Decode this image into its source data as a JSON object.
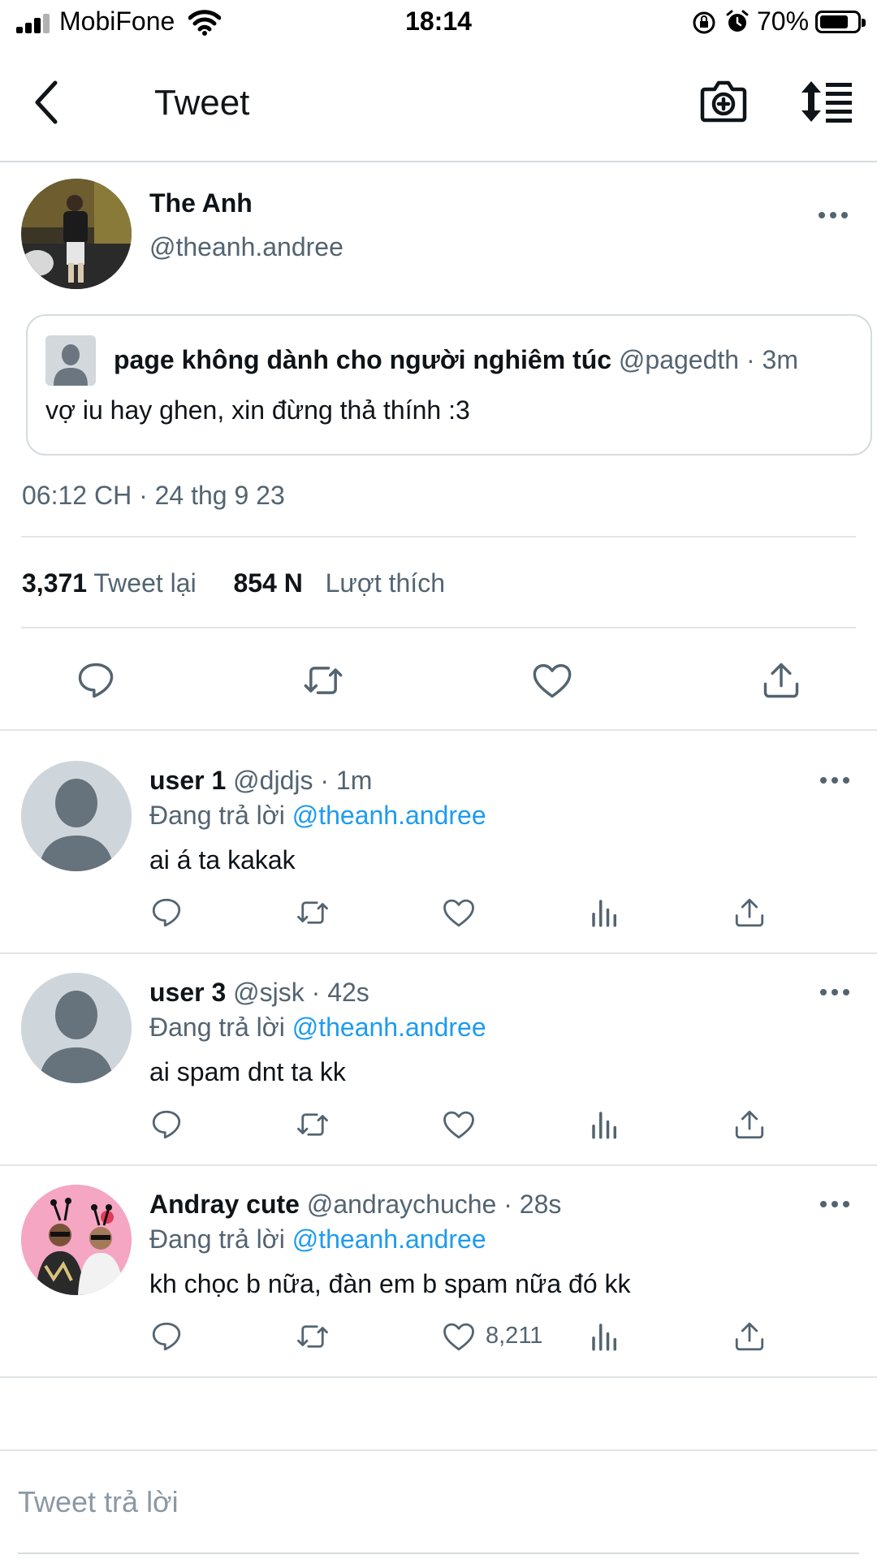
{
  "status_bar": {
    "carrier": "MobiFone",
    "time": "18:14",
    "battery_percent": "70%",
    "battery_level": 0.7
  },
  "nav": {
    "title": "Tweet",
    "back_icon": "chevron-left-icon",
    "camera_icon": "camera-plus-icon",
    "sort_icon": "sort-lines-icon"
  },
  "tweet": {
    "author_name": "The Anh",
    "author_handle": "@theanh.andree",
    "quote": {
      "name": "page không dành cho người nghiêm túc",
      "meta": "@pagedth · 3m",
      "text": "vợ iu hay ghen, xin đừng thả thính :3"
    },
    "timestamp": "06:12 CH · 24 thg 9 23",
    "retweet_count": "3,371",
    "retweet_label": "Tweet lại",
    "like_count": "854 N",
    "like_label": "Lượt thích"
  },
  "replies": [
    {
      "name": "user 1",
      "meta": "@djdjs · 1m",
      "replying_prefix": "Đang trả lời",
      "replying_to": "@theanh.andree",
      "text": "ai á ta kakak",
      "like_count": ""
    },
    {
      "name": "user 3",
      "meta": "@sjsk · 42s",
      "replying_prefix": "Đang trả lời",
      "replying_to": "@theanh.andree",
      "text": "ai spam dnt ta kk",
      "like_count": ""
    },
    {
      "name": "Andray cute",
      "meta": "@andraychuche · 28s",
      "replying_prefix": "Đang trả lời",
      "replying_to": "@theanh.andree",
      "text": "kh chọc b nữa, đàn em b spam nữa đó kk",
      "like_count": "8,211"
    }
  ],
  "compose": {
    "placeholder": "Tweet trả lời"
  },
  "colors": {
    "text": "#0f1419",
    "secondary": "#536471",
    "link": "#1d9bf0",
    "divider": "#e1e5e8"
  }
}
